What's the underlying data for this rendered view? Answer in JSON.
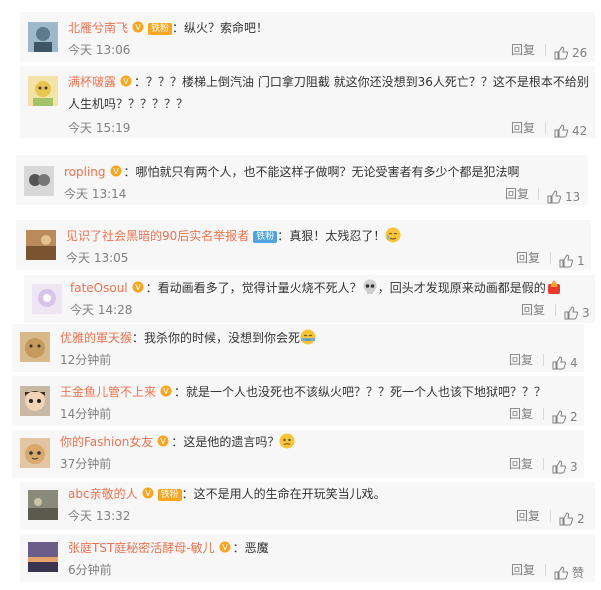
{
  "comments": [
    {
      "user": "北雁兮南飞",
      "fan_badge": "铁粉",
      "text": "纵火？索命吧！",
      "time": "今天 13:06",
      "reply": "回复",
      "likes": "26"
    },
    {
      "user": "满杯啵露",
      "fan_badge": "",
      "text": "？？？楼梯上倒汽油 门口拿刀阻截 就这你还没想到36人死亡？？这不是根本不给别",
      "text2": "人生机吗？？？？？？",
      "time": "今天 15:19",
      "reply": "回复",
      "likes": "42"
    },
    {
      "user": "ropling",
      "fan_badge": "",
      "text": "哪怕就只有两个人，也不能这样子做啊？无论受害者有多少个都是犯法啊",
      "time": "今天 13:14",
      "reply": "回复",
      "likes": "13"
    },
    {
      "user": "见识了社会黑暗的90后实名举报者",
      "fan_badge": "铁粉",
      "text": "真狠！太残忍了！",
      "time": "今天 13:05",
      "reply": "回复",
      "likes": "1"
    },
    {
      "user": "fateOsoul",
      "fan_badge": "",
      "text": "看动画看多了，觉得计量火烧不死人？",
      "text_b": "，回头才发现原来动画都是假的",
      "time": "今天 14:28",
      "reply": "回复",
      "likes": "3"
    },
    {
      "user": "优雅的軍天猴",
      "fan_badge": "",
      "text": "我杀你的时候，没想到你会死",
      "time": "12分钟前",
      "reply": "回复",
      "likes": "4"
    },
    {
      "user": "王金鱼儿管不上来",
      "fan_badge": "",
      "text": "就是一个人也没死也不该纵火吧？？？死一个人也该下地狱吧？？？",
      "time": "14分钟前",
      "reply": "回复",
      "likes": "2"
    },
    {
      "user": "你的Fashion女友",
      "fan_badge": "",
      "text": "这是他的遗言吗？",
      "time": "37分钟前",
      "reply": "回复",
      "likes": "3"
    },
    {
      "user": "abc亲敬的人",
      "fan_badge": "铁粉",
      "text": "这不是用人的生命在开玩笑当儿戏。",
      "time": "今天 13:32",
      "reply": "回复",
      "likes": "2"
    },
    {
      "user": "张庭TST庭秘密活酵母-敏儿",
      "fan_badge": "",
      "text": "恶魔",
      "time": "6分钟前",
      "reply": "回复",
      "likes": "赞"
    }
  ],
  "colors": {
    "username": "#eb7350",
    "text": "#333333",
    "meta": "#808080",
    "card_bg": "#f7f7f7"
  },
  "icons": {
    "like": "thumbs-up-icon",
    "verified": "verified-badge-icon"
  }
}
